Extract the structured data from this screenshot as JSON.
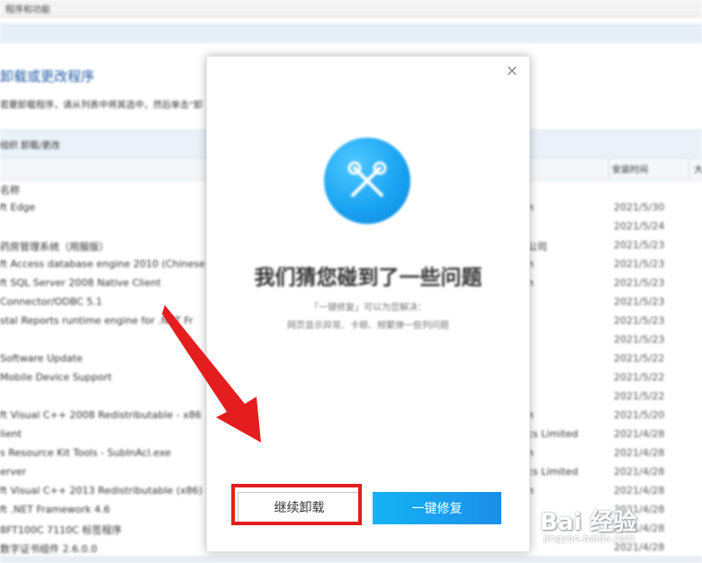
{
  "background": {
    "address_text": "程序和功能",
    "page_title": "卸载或更改程序",
    "page_desc": "若要卸载程序，请从列表中将其选中，然后单击“卸",
    "toolbar_label": "组织  卸载/更改",
    "header": {
      "name": "名称",
      "date": "安装时间",
      "size": "大"
    },
    "rows": [
      {
        "name": "ft Edge",
        "publisher": "n",
        "date": "2021/5/30"
      },
      {
        "name": "",
        "publisher": "",
        "date": "2021/5/24"
      },
      {
        "name": "药房管理系统（用服版）",
        "publisher": "公司",
        "date": "2021/5/23"
      },
      {
        "name": "ft Access database engine 2010 (Chinese",
        "publisher": "n",
        "date": "2021/5/23"
      },
      {
        "name": "ft SQL Server 2008 Native Client",
        "publisher": "n",
        "date": "2021/5/23"
      },
      {
        "name": "Connector/ODBC 5.1",
        "publisher": "",
        "date": "2021/5/23"
      },
      {
        "name": "stal Reports runtime engine for .NET Fr",
        "publisher": "",
        "date": "2021/5/23"
      },
      {
        "name": "",
        "publisher": "",
        "date": "2021/5/23"
      },
      {
        "name": "Software Update",
        "publisher": "",
        "date": "2021/5/22"
      },
      {
        "name": "Mobile Device Support",
        "publisher": "",
        "date": "2021/5/22"
      },
      {
        "name": "",
        "publisher": "",
        "date": "2021/5/22"
      },
      {
        "name": "ft Visual C++ 2008 Redistributable - x86",
        "publisher": "n",
        "date": "2021/5/20"
      },
      {
        "name": "lient",
        "publisher": "cs Limited",
        "date": "2021/4/28"
      },
      {
        "name": "s Resource Kit Tools - SubInAcl.exe",
        "publisher": "n",
        "date": "2021/4/28"
      },
      {
        "name": "erver",
        "publisher": "cs Limited",
        "date": "2021/4/28"
      },
      {
        "name": "ft Visual C++ 2013 Redistributable (x86)",
        "publisher": "n",
        "date": "2021/4/28"
      },
      {
        "name": "ft .NET Framework 4.6",
        "publisher": "",
        "date": "2021/4/28"
      },
      {
        "name": "8FT100C 7110C 标签程序",
        "publisher": "",
        "date": "2021/4/28"
      },
      {
        "name": "数字证书组件 2.6.0.0",
        "publisher": "",
        "date": "2021/4/28"
      }
    ]
  },
  "dialog": {
    "close_glyph": "×",
    "title": "我们猜您碰到了一些问题",
    "subtitle1": "「一键修复」可以为您解决：",
    "subtitle2": "网页显示异常、卡顿、频繁弹一些列问题",
    "continue_label": "继续卸载",
    "fix_label": "一键修复",
    "icon": "tools-icon",
    "colors": {
      "accent": "#1aa4f2",
      "button_from": "#14b4f5",
      "button_to": "#1b8ee8"
    }
  },
  "annotation": {
    "color": "#e41e1e"
  },
  "watermark": {
    "text": "Bai 经验",
    "url": "jingyan.baidu.com"
  }
}
